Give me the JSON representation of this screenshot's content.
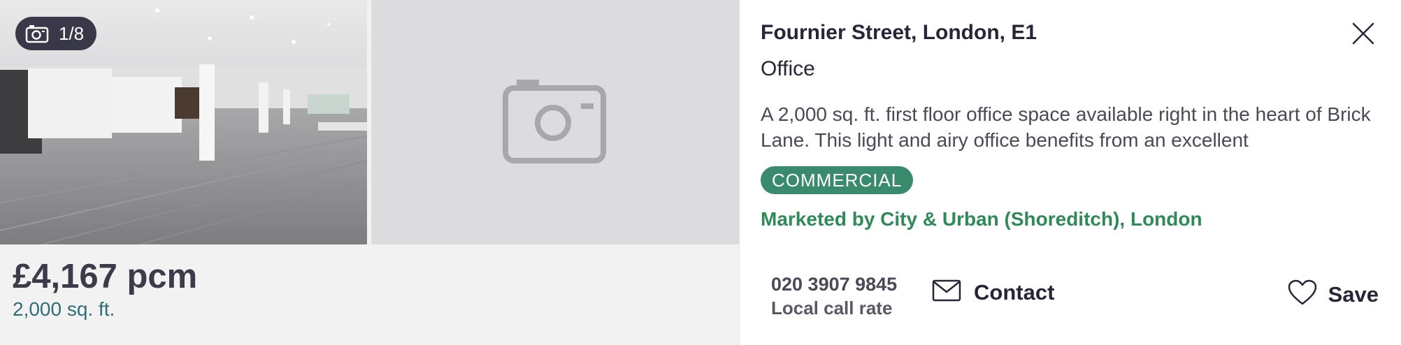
{
  "listing": {
    "photo_counter": "1/8",
    "price": "£4,167 pcm",
    "size": "2,000 sq. ft.",
    "address": "Fournier Street, London, E1",
    "property_type": "Office",
    "description": "A 2,000 sq. ft. first floor office space available right in the heart of Brick Lane. This light and airy office benefits from an excellent",
    "badge": "COMMERCIAL",
    "marketed_by": "Marketed by City & Urban (Shoreditch), London"
  },
  "actions": {
    "phone": "020 3907 9845",
    "call_rate": "Local call rate",
    "contact_label": "Contact",
    "save_label": "Save"
  },
  "icons": {
    "counter": "camera-icon",
    "placeholder": "camera-placeholder-icon",
    "close": "close-icon",
    "contact": "envelope-icon",
    "save": "heart-icon"
  },
  "colors": {
    "badge_bg": "#3a8a6e",
    "agent_text": "#2e8b57",
    "size_text": "#2f6e77",
    "counter_bg": "#262637"
  }
}
